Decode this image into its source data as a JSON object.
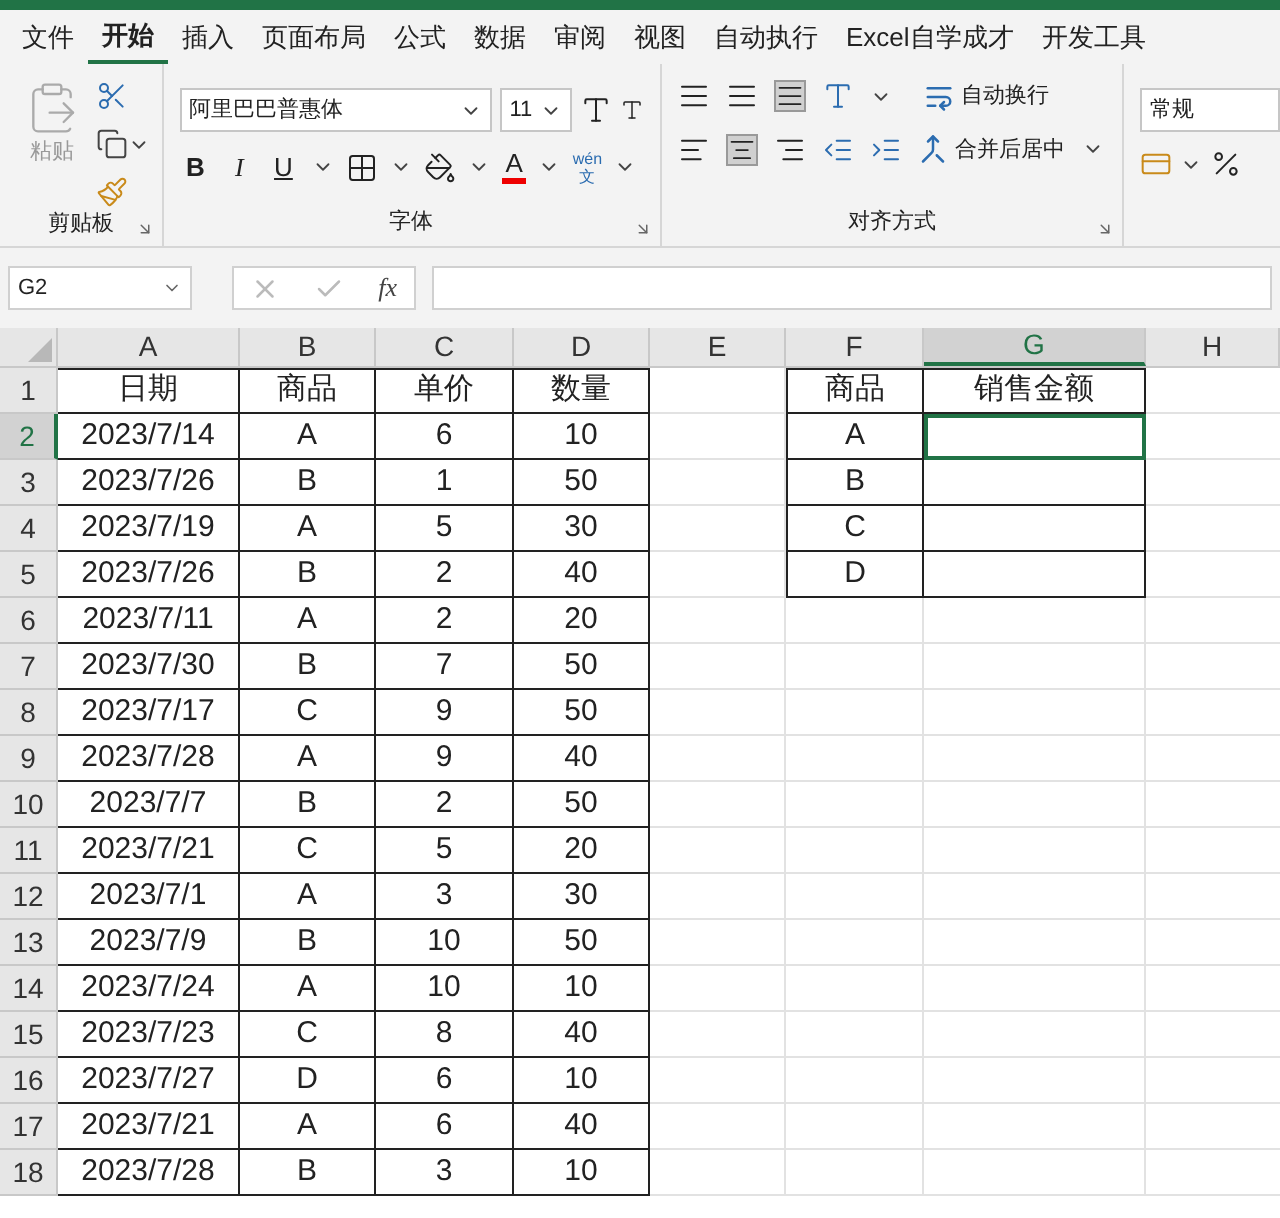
{
  "menu_tabs": [
    {
      "label": "文件",
      "selected": false
    },
    {
      "label": "开始",
      "selected": true
    },
    {
      "label": "插入",
      "selected": false
    },
    {
      "label": "页面布局",
      "selected": false
    },
    {
      "label": "公式",
      "selected": false
    },
    {
      "label": "数据",
      "selected": false
    },
    {
      "label": "审阅",
      "selected": false
    },
    {
      "label": "视图",
      "selected": false
    },
    {
      "label": "自动执行",
      "selected": false
    },
    {
      "label": "Excel自学成才",
      "selected": false
    },
    {
      "label": "开发工具",
      "selected": false
    }
  ],
  "ribbon": {
    "clipboard": {
      "paste_label": "粘贴",
      "group_label": "剪贴板"
    },
    "font": {
      "name": "阿里巴巴普惠体",
      "size": "11",
      "bold": "B",
      "italic": "I",
      "underline": "U",
      "font_color": "A",
      "phonetic_top": "wén",
      "phonetic_bottom": "文",
      "group_label": "字体"
    },
    "alignment": {
      "wrap": "自动换行",
      "merge": "合并后居中",
      "group_label": "对齐方式"
    },
    "number": {
      "format": "常规"
    }
  },
  "formula_bar": {
    "name_box": "G2",
    "function_label": "fx"
  },
  "sheet": {
    "columns": [
      {
        "label": "A",
        "selected": false
      },
      {
        "label": "B",
        "selected": false
      },
      {
        "label": "C",
        "selected": false
      },
      {
        "label": "D",
        "selected": false
      },
      {
        "label": "E",
        "selected": false
      },
      {
        "label": "F",
        "selected": false
      },
      {
        "label": "G",
        "selected": true
      },
      {
        "label": "H",
        "selected": false
      }
    ],
    "rows": [
      {
        "header": "1",
        "selected": false,
        "cells": [
          "日期",
          "商品",
          "单价",
          "数量"
        ],
        "lookup": [
          {
            "text": "商品",
            "selected": false
          },
          {
            "text": "销售金额",
            "selected": false
          }
        ]
      },
      {
        "header": "2",
        "selected": true,
        "cells": [
          "2023/7/14",
          "A",
          "6",
          "10"
        ],
        "lookup": [
          {
            "text": "A",
            "selected": false
          },
          {
            "selected": true
          }
        ]
      },
      {
        "header": "3",
        "selected": false,
        "cells": [
          "2023/7/26",
          "B",
          "1",
          "50"
        ],
        "lookup": [
          {
            "text": "B",
            "selected": false
          },
          {
            "selected": false
          }
        ]
      },
      {
        "header": "4",
        "selected": false,
        "cells": [
          "2023/7/19",
          "A",
          "5",
          "30"
        ],
        "lookup": [
          {
            "text": "C",
            "selected": false
          },
          {
            "selected": false
          }
        ]
      },
      {
        "header": "5",
        "selected": false,
        "cells": [
          "2023/7/26",
          "B",
          "2",
          "40"
        ],
        "lookup": [
          {
            "text": "D",
            "selected": false
          },
          {
            "selected": false
          }
        ]
      },
      {
        "header": "6",
        "selected": false,
        "cells": [
          "2023/7/11",
          "A",
          "2",
          "20"
        ]
      },
      {
        "header": "7",
        "selected": false,
        "cells": [
          "2023/7/30",
          "B",
          "7",
          "50"
        ]
      },
      {
        "header": "8",
        "selected": false,
        "cells": [
          "2023/7/17",
          "C",
          "9",
          "50"
        ]
      },
      {
        "header": "9",
        "selected": false,
        "cells": [
          "2023/7/28",
          "A",
          "9",
          "40"
        ]
      },
      {
        "header": "10",
        "selected": false,
        "cells": [
          "2023/7/7",
          "B",
          "2",
          "50"
        ]
      },
      {
        "header": "11",
        "selected": false,
        "cells": [
          "2023/7/21",
          "C",
          "5",
          "20"
        ]
      },
      {
        "header": "12",
        "selected": false,
        "cells": [
          "2023/7/1",
          "A",
          "3",
          "30"
        ]
      },
      {
        "header": "13",
        "selected": false,
        "cells": [
          "2023/7/9",
          "B",
          "10",
          "50"
        ]
      },
      {
        "header": "14",
        "selected": false,
        "cells": [
          "2023/7/24",
          "A",
          "10",
          "10"
        ]
      },
      {
        "header": "15",
        "selected": false,
        "cells": [
          "2023/7/23",
          "C",
          "8",
          "40"
        ]
      },
      {
        "header": "16",
        "selected": false,
        "cells": [
          "2023/7/27",
          "D",
          "6",
          "10"
        ]
      },
      {
        "header": "17",
        "selected": false,
        "cells": [
          "2023/7/21",
          "A",
          "6",
          "40"
        ]
      },
      {
        "header": "18",
        "selected": false,
        "cells": [
          "2023/7/28",
          "B",
          "3",
          "10"
        ]
      }
    ]
  }
}
